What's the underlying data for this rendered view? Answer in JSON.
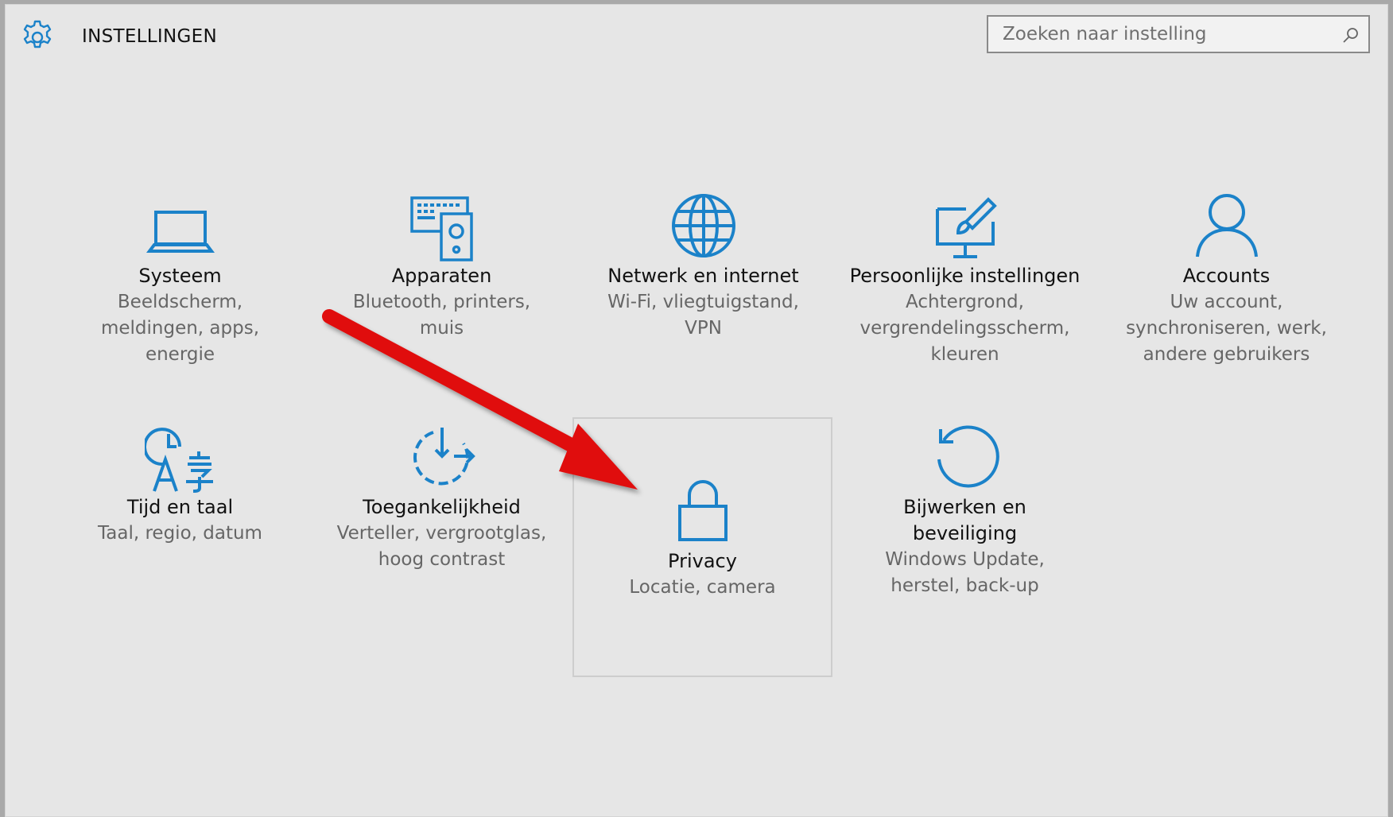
{
  "header": {
    "title": "INSTELLINGEN",
    "search_placeholder": "Zoeken naar instelling"
  },
  "tiles": [
    {
      "name": "Systeem",
      "desc": "Beeldscherm,\nmeldingen, apps,\nenergie",
      "icon": "laptop-icon"
    },
    {
      "name": "Apparaten",
      "desc": "Bluetooth, printers,\nmuis",
      "icon": "devices-icon"
    },
    {
      "name": "Netwerk en internet",
      "desc": "Wi-Fi, vliegtuigstand,\nVPN",
      "icon": "globe-icon"
    },
    {
      "name": "Persoonlijke instellingen",
      "desc": "Achtergrond,\nvergrendelingsscherm,\nkleuren",
      "icon": "personalization-icon"
    },
    {
      "name": "Accounts",
      "desc": "Uw account,\nsynchroniseren, werk,\nandere gebruikers",
      "icon": "person-icon"
    },
    {
      "name": "Tijd en taal",
      "desc": "Taal, regio, datum",
      "icon": "time-language-icon"
    },
    {
      "name": "Toegankelijkheid",
      "desc": "Verteller, vergrootglas,\nhoog contrast",
      "icon": "ease-of-access-icon"
    },
    {
      "name": "Privacy",
      "desc": "Locatie, camera",
      "icon": "lock-icon"
    },
    {
      "name": "Bijwerken en\nbeveiliging",
      "desc": "Windows Update,\nherstel, back-up",
      "icon": "update-icon"
    }
  ],
  "colors": {
    "accent": "#1b82c9",
    "annotation_arrow": "#e01010"
  }
}
